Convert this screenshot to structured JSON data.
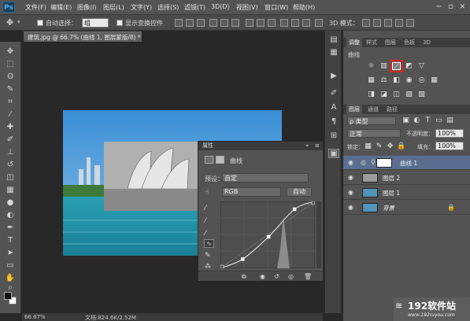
{
  "app": {
    "logo": "Ps"
  },
  "menu": [
    "文件(F)",
    "编辑(E)",
    "图像(I)",
    "图层(L)",
    "文字(Y)",
    "选择(S)",
    "滤镜(T)",
    "3D(D)",
    "视图(V)",
    "窗口(W)",
    "帮助(H)"
  ],
  "window_controls": {
    "minimize": "−",
    "restore": "▫",
    "close": "×"
  },
  "options": {
    "auto_select_label": "自动选择：",
    "auto_select_value": "组",
    "show_transform_label": "显示变换控件",
    "mode_3d_label": "3D 模式："
  },
  "document": {
    "tab_title": "建筑.jpg @ 66.7% (曲线 1, 图层蒙版/8) *",
    "close_glyph": "×",
    "zoom": "66.67%",
    "doc_info": "文档:824.6K/2.52M"
  },
  "properties": {
    "header": "属性",
    "title": "曲线",
    "preset_label": "预设：",
    "preset_value": "自定",
    "channel_value": "RGB",
    "auto_button": "自动"
  },
  "adjustments": {
    "tabs": [
      "调整",
      "样式",
      "图层",
      "色板",
      "3D"
    ],
    "add_label": "曲线"
  },
  "layers_panel": {
    "tabs": [
      "图层",
      "通道",
      "路径"
    ],
    "filter_value": "ρ 类型",
    "blend_mode": "正常",
    "opacity_label": "不透明度：",
    "opacity_value": "100%",
    "lock_label": "锁定：",
    "fill_label": "填充：",
    "fill_value": "100%",
    "layers": [
      {
        "name": "曲线 1",
        "selected": true
      },
      {
        "name": "图层 2",
        "selected": false
      },
      {
        "name": "图层 1",
        "selected": false
      },
      {
        "name": "背景",
        "selected": false
      }
    ]
  },
  "watermark": {
    "brand": "192软件站",
    "url": "www.192ruyou.com"
  },
  "chart_data": {
    "type": "line",
    "x": [
      0,
      60,
      130,
      200,
      255
    ],
    "y": [
      0,
      35,
      120,
      225,
      255
    ],
    "xlim": [
      0,
      255
    ],
    "ylim": [
      0,
      255
    ]
  },
  "colors": {
    "highlight_box": "#e02020",
    "selected_layer": "#5a6f8f",
    "accent": "#48b4f0"
  }
}
